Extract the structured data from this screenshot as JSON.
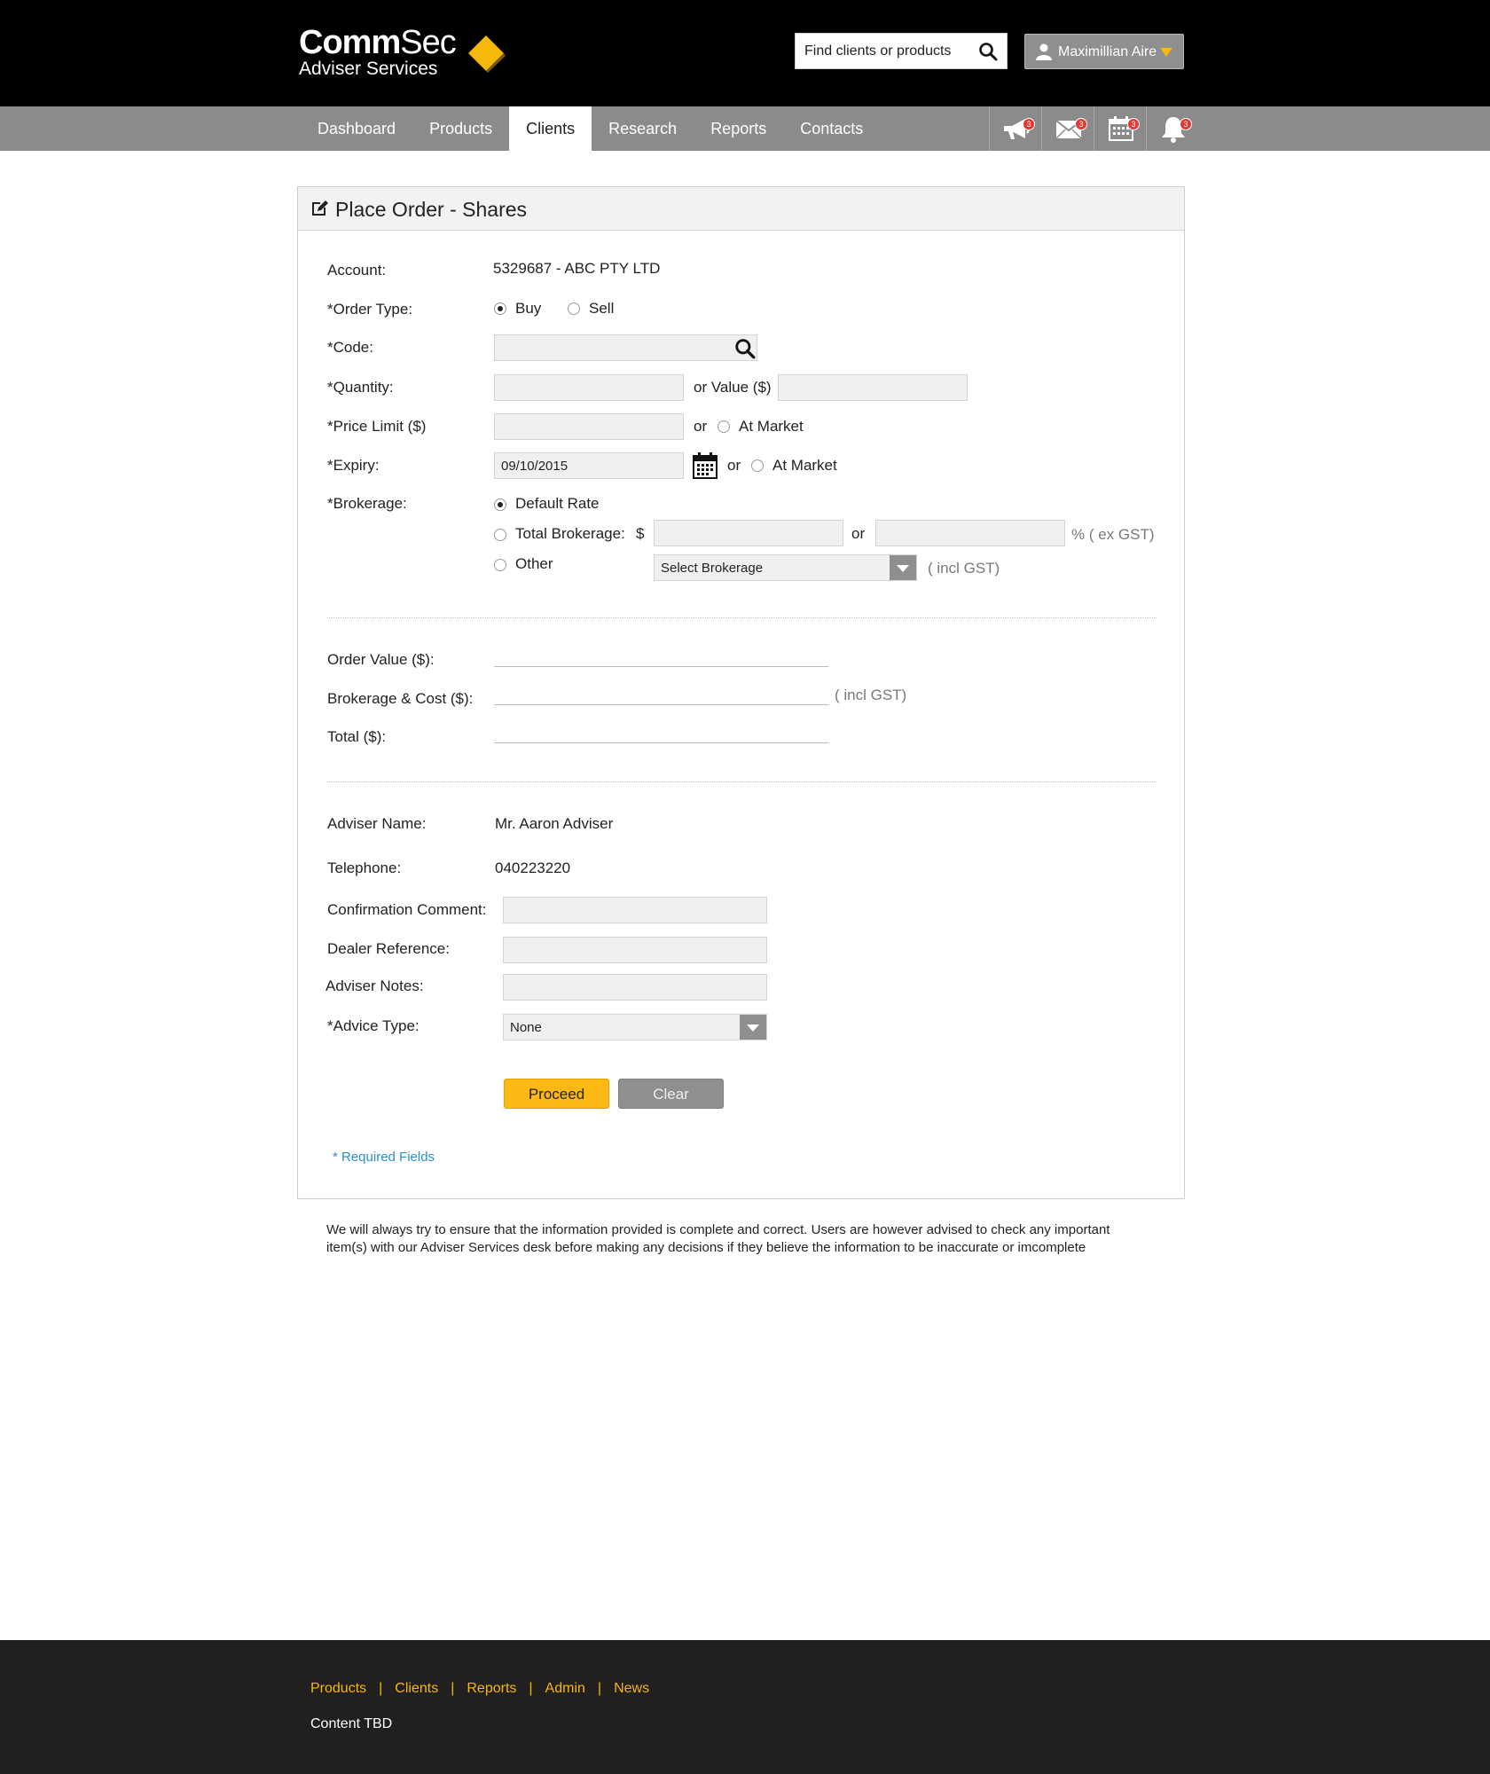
{
  "brand": {
    "logo_main": "Comm",
    "logo_sec": "Sec",
    "logo_sub": "Adviser Services",
    "accent": "#f6b80a"
  },
  "header": {
    "search_placeholder": "Find clients or products",
    "search_icon": "search-icon",
    "user_name": "Maximillian Aire"
  },
  "nav": {
    "tabs": [
      {
        "label": "Dashboard"
      },
      {
        "label": "Products"
      },
      {
        "label": "Clients",
        "active": true
      },
      {
        "label": "Research"
      },
      {
        "label": "Reports"
      },
      {
        "label": "Contacts"
      }
    ],
    "icons": [
      {
        "name": "megaphone-icon",
        "badge": "3"
      },
      {
        "name": "mail-icon",
        "badge": "3"
      },
      {
        "name": "calendar-icon",
        "badge": "3"
      },
      {
        "name": "bell-icon",
        "badge": "3"
      }
    ]
  },
  "form": {
    "title": "Place Order - Shares",
    "account_label": "Account:",
    "account_value": "5329687 - ABC PTY LTD",
    "order_type_label": "*Order Type:",
    "order_type_buy": "Buy",
    "order_type_sell": "Sell",
    "code_label": "*Code:",
    "quantity_label": "*Quantity:",
    "or_value_label": "or Value ($)",
    "price_limit_label": "*Price Limit ($)",
    "or": "or",
    "at_market": "At Market",
    "expiry_label": "*Expiry:",
    "expiry_value": "09/10/2015",
    "brokerage_label": "*Brokerage:",
    "default_rate": "Default Rate",
    "total_brokerage": "Total Brokerage:",
    "dollar": "$",
    "pct_ex_gst": "% ( ex GST)",
    "other": "Other",
    "select_brokerage": "Select Brokerage",
    "incl_gst": "( incl GST)",
    "order_value_label": "Order Value ($):",
    "brokerage_cost_label": "Brokerage & Cost ($):",
    "total_label": "Total ($):",
    "adviser_name_label": "Adviser Name:",
    "adviser_name_value": "Mr. Aaron Adviser",
    "telephone_label": "Telephone:",
    "telephone_value": "040223220",
    "confirmation_comment_label": "Confirmation Comment:",
    "dealer_reference_label": "Dealer Reference:",
    "adviser_notes_label": "Adviser Notes:",
    "advice_type_label": "*Advice Type:",
    "advice_type_value": "None",
    "proceed": "Proceed",
    "clear": "Clear",
    "required_note": "* Required Fields"
  },
  "disclaimer": "We will always try to ensure that the information provided is complete and correct. Users are however advised to check any important item(s) with our Adviser Services desk before making any decisions if they believe the information to be inaccurate or imcomplete",
  "footer": {
    "links": [
      "Products",
      "Clients",
      "Reports",
      "Admin",
      "News"
    ],
    "content": "Content TBD"
  }
}
